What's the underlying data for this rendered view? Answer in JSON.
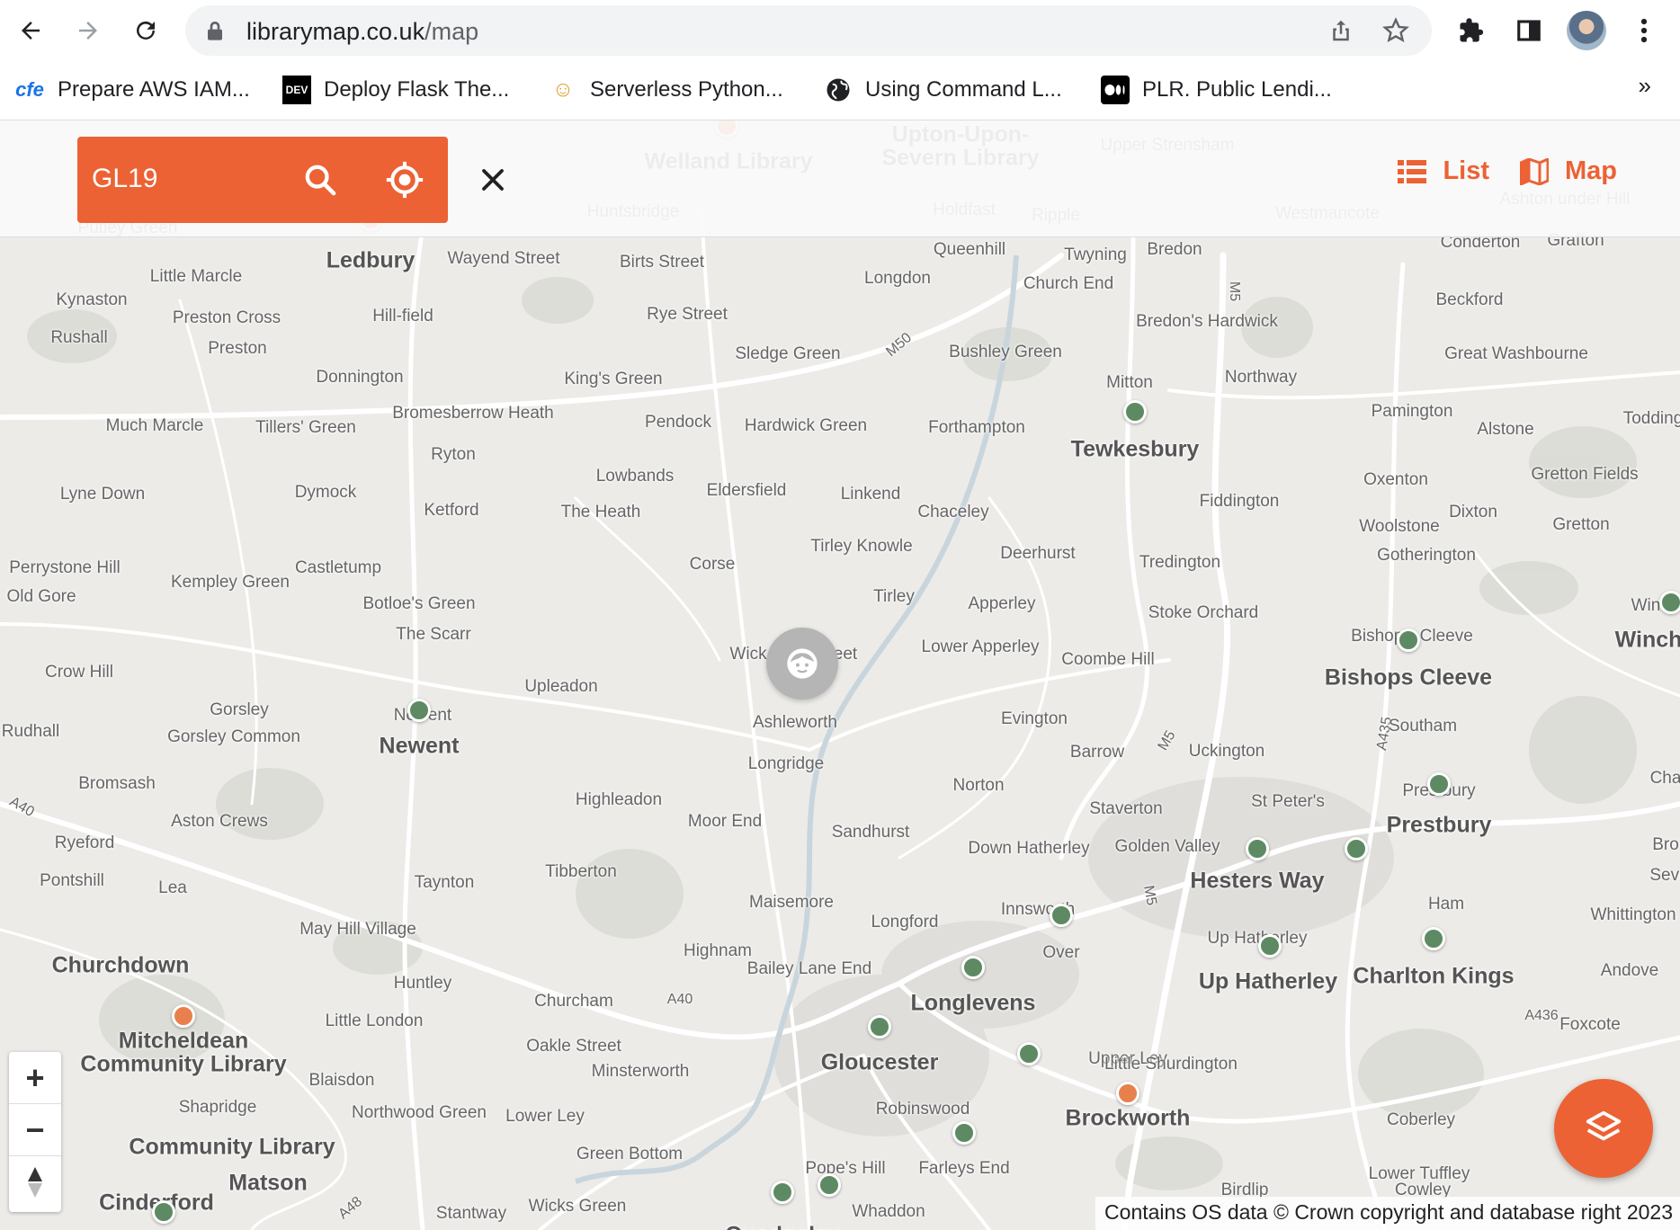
{
  "browser": {
    "url_domain": "librarymap.co.uk",
    "url_path": "/map",
    "bookmarks": [
      {
        "icon": "cfe",
        "label": "Prepare AWS IAM..."
      },
      {
        "icon": "DEV",
        "label": "Deploy Flask The..."
      },
      {
        "icon": "emoji-face-icon",
        "label": "Serverless Python..."
      },
      {
        "icon": "globe-icon",
        "label": "Using Command L..."
      },
      {
        "icon": "medium-icon",
        "label": "PLR. Public Lendi..."
      }
    ],
    "bookmarks_more": "»"
  },
  "header": {
    "search_query": "GL19",
    "list_label": "List",
    "map_label": "Map"
  },
  "map": {
    "labels": [
      {
        "text": "Welland Library",
        "big": true
      },
      {
        "text": "Upton-Upon-",
        "big": true
      },
      {
        "text": "Severn Library",
        "big": true
      },
      {
        "text": "Upper Strensham"
      },
      {
        "text": "Huntsbridge"
      },
      {
        "text": "Holdfast"
      },
      {
        "text": "Ripple"
      },
      {
        "text": "Westmancote"
      },
      {
        "text": "Ashton under Hill"
      },
      {
        "text": "Putley Green"
      },
      {
        "text": "Ledbury",
        "big": true
      },
      {
        "text": "Wayend Street"
      },
      {
        "text": "Birts Street"
      },
      {
        "text": "Queenhill"
      },
      {
        "text": "Twyning"
      },
      {
        "text": "Bredon"
      },
      {
        "text": "Conderton"
      },
      {
        "text": "Grafton"
      },
      {
        "text": "Little Marcle"
      },
      {
        "text": "Kynaston"
      },
      {
        "text": "Preston Cross"
      },
      {
        "text": "Hill-field"
      },
      {
        "text": "Rye Street"
      },
      {
        "text": "Longdon"
      },
      {
        "text": "Church End"
      },
      {
        "text": "Bredon's Hardwick"
      },
      {
        "text": "Beckford"
      },
      {
        "text": "Rushall"
      },
      {
        "text": "Preston"
      },
      {
        "text": "Sledge Green"
      },
      {
        "text": "Bushley Green"
      },
      {
        "text": "Great Washbourne"
      },
      {
        "text": "Donnington"
      },
      {
        "text": "King's Green"
      },
      {
        "text": "Mitton"
      },
      {
        "text": "Northway"
      },
      {
        "text": "Bromesberrow Heath"
      },
      {
        "text": "Pendock"
      },
      {
        "text": "Hardwick Green"
      },
      {
        "text": "Forthampton"
      },
      {
        "text": "Pamington"
      },
      {
        "text": "Much Marcle"
      },
      {
        "text": "Tillers' Green"
      },
      {
        "text": "Tewkesbury",
        "big": true
      },
      {
        "text": "Alstone"
      },
      {
        "text": "Todding"
      },
      {
        "text": "Ryton"
      },
      {
        "text": "Lowbands"
      },
      {
        "text": "Gretton Fields"
      },
      {
        "text": "Lyne Down"
      },
      {
        "text": "Dymock"
      },
      {
        "text": "Eldersfield"
      },
      {
        "text": "Linkend"
      },
      {
        "text": "Oxenton"
      },
      {
        "text": "Fiddington"
      },
      {
        "text": "Ketford"
      },
      {
        "text": "The Heath"
      },
      {
        "text": "Chaceley"
      },
      {
        "text": "Dixton"
      },
      {
        "text": "Woolstone"
      },
      {
        "text": "Gretton"
      },
      {
        "text": "Tirley Knowle"
      },
      {
        "text": "Deerhurst"
      },
      {
        "text": "Gotherington"
      },
      {
        "text": "Perrystone Hill"
      },
      {
        "text": "Castletump"
      },
      {
        "text": "Corse"
      },
      {
        "text": "Tredington"
      },
      {
        "text": "Kempley Green"
      },
      {
        "text": "Old Gore"
      },
      {
        "text": "Botloe's Green"
      },
      {
        "text": "Tirley"
      },
      {
        "text": "Apperley"
      },
      {
        "text": "Stoke Orchard"
      },
      {
        "text": "Winch"
      },
      {
        "text": "The Scarr"
      },
      {
        "text": "Bishop's Cleeve"
      },
      {
        "text": "Winchc",
        "big": true
      },
      {
        "text": "Wick"
      },
      {
        "text": "eet"
      },
      {
        "text": "Lower Apperley"
      },
      {
        "text": "Coombe Hill"
      },
      {
        "text": "Crow Hill"
      },
      {
        "text": "Upleadon"
      },
      {
        "text": "Bishops Cleeve",
        "big": true
      },
      {
        "text": "Gorsley"
      },
      {
        "text": "Newent"
      },
      {
        "text": "Ashleworth"
      },
      {
        "text": "Evington"
      },
      {
        "text": "Rudhall"
      },
      {
        "text": "Newent",
        "big": true
      },
      {
        "text": "Gorsley Common"
      },
      {
        "text": "Southam"
      },
      {
        "text": "Barrow"
      },
      {
        "text": "Uckington"
      },
      {
        "text": "Longridge"
      },
      {
        "text": "Bromsash"
      },
      {
        "text": "Norton"
      },
      {
        "text": "Cha"
      },
      {
        "text": "Prestbury"
      },
      {
        "text": "St Peter's"
      },
      {
        "text": "Highleadon"
      },
      {
        "text": "Staverton"
      },
      {
        "text": "Aston Crews"
      },
      {
        "text": "Moor End"
      },
      {
        "text": "Prestbury",
        "big": true
      },
      {
        "text": "Sandhurst"
      },
      {
        "text": "Ryeford"
      },
      {
        "text": "Down Hatherley"
      },
      {
        "text": "Golden Valley"
      },
      {
        "text": "Bro"
      },
      {
        "text": "Tibberton"
      },
      {
        "text": "Pontshill"
      },
      {
        "text": "Hesters Way",
        "big": true
      },
      {
        "text": "Seve"
      },
      {
        "text": "Lea"
      },
      {
        "text": "Taynton"
      },
      {
        "text": "Maisemore"
      },
      {
        "text": "Ham"
      },
      {
        "text": "Whittington"
      },
      {
        "text": "Innsworth"
      },
      {
        "text": "Longford"
      },
      {
        "text": "May Hill Village"
      },
      {
        "text": "Up Hatherley"
      },
      {
        "text": "Highnam"
      },
      {
        "text": "Churchdown",
        "big": true
      },
      {
        "text": "Bailey Lane End"
      },
      {
        "text": "Over"
      },
      {
        "text": "Charlton Kings",
        "big": true
      },
      {
        "text": "Andove"
      },
      {
        "text": "Huntley"
      },
      {
        "text": "Up Hatherley",
        "big": true
      },
      {
        "text": "Churcham"
      },
      {
        "text": "Longlevens",
        "big": true
      },
      {
        "text": "Little London"
      },
      {
        "text": "Foxcote"
      },
      {
        "text": "Mitcheldean",
        "big": true
      },
      {
        "text": "Oakle Street"
      },
      {
        "text": "Community Library",
        "big": true
      },
      {
        "text": "Upper Ley"
      },
      {
        "text": "Gloucester",
        "big": true
      },
      {
        "text": "Little Shurdington"
      },
      {
        "text": "Minsterworth"
      },
      {
        "text": "Blaisdon"
      },
      {
        "text": "Shapridge"
      },
      {
        "text": "Robinswood"
      },
      {
        "text": "Northwood Green"
      },
      {
        "text": "Lower Ley"
      },
      {
        "text": "Brockworth",
        "big": true
      },
      {
        "text": "Coberley"
      },
      {
        "text": "Community Library",
        "big": true
      },
      {
        "text": "Green Bottom"
      },
      {
        "text": "Farleys End"
      },
      {
        "text": "Matson",
        "big": true
      },
      {
        "text": "Pope's Hill"
      },
      {
        "text": "Lower Tuffley"
      },
      {
        "text": "Cowley"
      },
      {
        "text": "Birdlip"
      },
      {
        "text": "Cinderford",
        "big": true
      },
      {
        "text": "Stantway"
      },
      {
        "text": "Wicks Green"
      },
      {
        "text": "Whaddon"
      },
      {
        "text": "Quedgeley",
        "big": true
      }
    ],
    "road_labels": [
      "M50",
      "M5",
      "M5",
      "M5",
      "A40",
      "A40",
      "A435",
      "A436",
      "A48"
    ],
    "attribution": "Contains OS data © Crown copyright and database right 2023",
    "zoom_in": "+",
    "zoom_out": "−",
    "compass": "▲"
  },
  "colors": {
    "accent": "#ec6234",
    "library_marker": "#5d8a62",
    "library_marker_alt": "#e8804d"
  }
}
